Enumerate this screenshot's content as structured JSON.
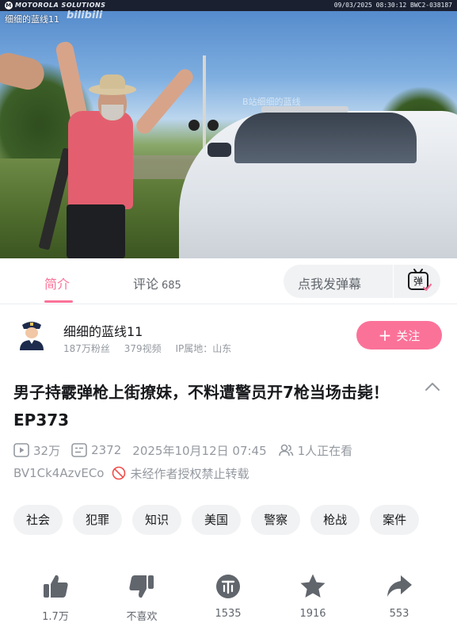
{
  "video": {
    "bodycam_brand": "MOTOROLA SOLUTIONS",
    "bodycam_info": "09/03/2025 08:30:12 BWC2-038187",
    "watermark_channel": "细细的蓝线11",
    "watermark_logo": "bilibili",
    "watermark_center": "B站细细的蓝线"
  },
  "tabs": {
    "intro_label": "简介",
    "comments_label": "评论",
    "comments_count": "685",
    "danmaku_placeholder": "点我发弹幕",
    "danmaku_icon_text": "弹"
  },
  "uploader": {
    "name": "细细的蓝线11",
    "followers": "187万粉丝",
    "videos": "379视频",
    "ip_location": "IP属地：山东",
    "follow_label": "关注"
  },
  "video_info": {
    "title": "男子持霰弹枪上街撩妹，不料遭警员开7枪当场击毙！EP373",
    "plays": "32万",
    "danmaku_count": "2372",
    "publish_time": "2025年10月12日 07:45",
    "watching_now": "1人正在看",
    "bvid": "BV1Ck4AzvECo",
    "copyright_notice": "未经作者授权禁止转载"
  },
  "tags": [
    "社会",
    "犯罪",
    "知识",
    "美国",
    "警察",
    "枪战",
    "案件"
  ],
  "actions": {
    "like": "1.7万",
    "dislike": "不喜欢",
    "coin": "1535",
    "favorite": "1916",
    "share": "553"
  },
  "colors": {
    "accent_pink": "#fb7299",
    "text_primary": "#18191c",
    "text_secondary": "#61666d",
    "text_tertiary": "#9499a0",
    "tag_bg": "#f1f2f3"
  },
  "icons": {
    "collapse": "chevron-up-icon",
    "plays": "play-icon",
    "danmaku": "danmaku-icon",
    "watching": "people-icon",
    "no_repost": "forbidden-icon",
    "like": "thumb-up-icon",
    "dislike": "thumb-down-icon",
    "coin": "coin-icon",
    "favorite": "star-icon",
    "share": "share-icon"
  }
}
